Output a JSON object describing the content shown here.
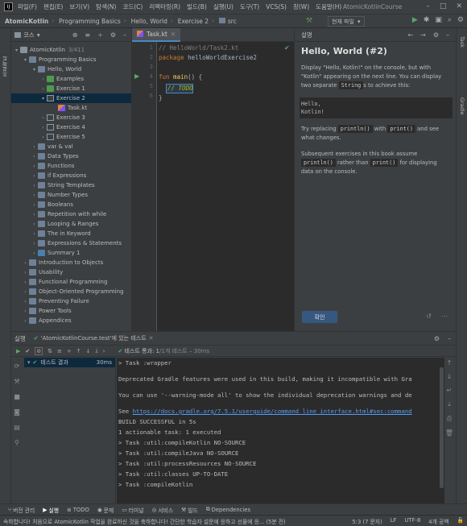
{
  "menubar": {
    "items": [
      "파일(F)",
      "편집(E)",
      "보기(V)",
      "탐색(N)",
      "코드(C)",
      "리팩터링(R)",
      "빌드(B)",
      "실행(U)",
      "도구(T)",
      "VCS(S)",
      "창(W)",
      "도움말(H)"
    ],
    "window_title": "AtomicKotlinCourse"
  },
  "navbar": {
    "crumbs": [
      "AtomicKotlin",
      "Programming Basics",
      "Hello, World",
      "Exercise 2",
      "src"
    ],
    "run_config": "현재 파일"
  },
  "left_stripe": {
    "project_label": "프로젝트"
  },
  "right_stripe": {
    "task_label": "Task",
    "gradle_label": "Gradle"
  },
  "project_panel": {
    "title": "코스",
    "root": "AtomicKotlin",
    "root_progress": "3/411",
    "items": [
      {
        "label": "Programming Basics"
      },
      {
        "label": "Hello, World"
      },
      {
        "label": "Examples"
      },
      {
        "label": "Exercise 1"
      },
      {
        "label": "Exercise 2"
      },
      {
        "label": "Task.kt"
      },
      {
        "label": "Exercise 3"
      },
      {
        "label": "Exercise 4"
      },
      {
        "label": "Exercise 5"
      },
      {
        "label": "var & val"
      },
      {
        "label": "Data Types"
      },
      {
        "label": "Functions"
      },
      {
        "label": "if Expressions"
      },
      {
        "label": "String Templates"
      },
      {
        "label": "Number Types"
      },
      {
        "label": "Booleans"
      },
      {
        "label": "Repetition with while"
      },
      {
        "label": "Looping & Ranges"
      },
      {
        "label": "The in Keyword"
      },
      {
        "label": "Expressions & Statements"
      },
      {
        "label": "Summary 1"
      },
      {
        "label": "Introduction to Objects"
      },
      {
        "label": "Usability"
      },
      {
        "label": "Functional Programming"
      },
      {
        "label": "Object-Oriented Programming"
      },
      {
        "label": "Preventing Failure"
      },
      {
        "label": "Power Tools"
      },
      {
        "label": "Appendices"
      }
    ]
  },
  "editor": {
    "tab_label": "Task.kt",
    "line_numbers": [
      "1",
      "2",
      "3",
      "4",
      "5",
      "6"
    ],
    "lines": {
      "l1": "// HelloWorld/Task2.kt",
      "l2_kw": "package",
      "l2_rest": " helloWorldExercise2",
      "l4_kw": "fun",
      "l4_fn": " main",
      "l4_rest": "() {",
      "l5_todo": "// TODO",
      "l6": "}"
    }
  },
  "description": {
    "header": "설명",
    "title": "Hello, World (#2)",
    "p1_a": "Display \"Hello, Kotlin!\" on the console, but with \"Kotlin\" appearing on the next line. You can display two separate ",
    "p1_code": "String",
    "p1_b": "s to achieve this:",
    "pre": "Hello,\nKotlin!",
    "p2_a": "Try replacing ",
    "p2_code1": "println()",
    "p2_b": " with ",
    "p2_code2": "print()",
    "p2_c": " and see what changes.",
    "p3_a": "Subsequent exercises in this book assume ",
    "p3_code1": "println()",
    "p3_b": " rather than ",
    "p3_code2": "print()",
    "p3_c": " for displaying data on the console.",
    "check_button": "확인"
  },
  "run_panel": {
    "title": "실행",
    "tab_label": "'AtomicKotlinCourse.test'에 있는 테스트",
    "passed_label": "테스트 통과: 1",
    "passed_detail": "/1개 테스트 – 30ms",
    "test_result_label": "테스트 결과",
    "test_result_time": "30ms",
    "console": [
      "> Task :wrapper",
      "Deprecated Gradle features were used in this build, making it incompatible with Gra",
      "You can use '--warning-mode all' to show the individual deprecation warnings and de",
      "See ",
      "https://docs.gradle.org/7.5.1/userguide/command_line_interface.html#sec:command",
      "BUILD SUCCESSFUL in 5s",
      "1 actionable task: 1 executed",
      "> Task :util:compileKotlin NO-SOURCE",
      "> Task :util:compileJava NO-SOURCE",
      "> Task :util:processResources NO-SOURCE",
      "> Task :util:classes UP-TO-DATE",
      "> Task :compileKotlin"
    ]
  },
  "tool_windows": [
    "버전 관리",
    "실행",
    "TODO",
    "문제",
    "터미널",
    "서비스",
    "빌드",
    "Dependencies"
  ],
  "status": {
    "message": "속하합니다! 처음으로 AtomicKotlin 작업을 완료하신 것을 축하합니다! 간단한 학습자 설문에 응하고 선물에 응... (5분 전)",
    "position": "5:3 (7 문자)",
    "line_sep": "LF",
    "encoding": "UTF-8",
    "indent": "4개 공백"
  }
}
